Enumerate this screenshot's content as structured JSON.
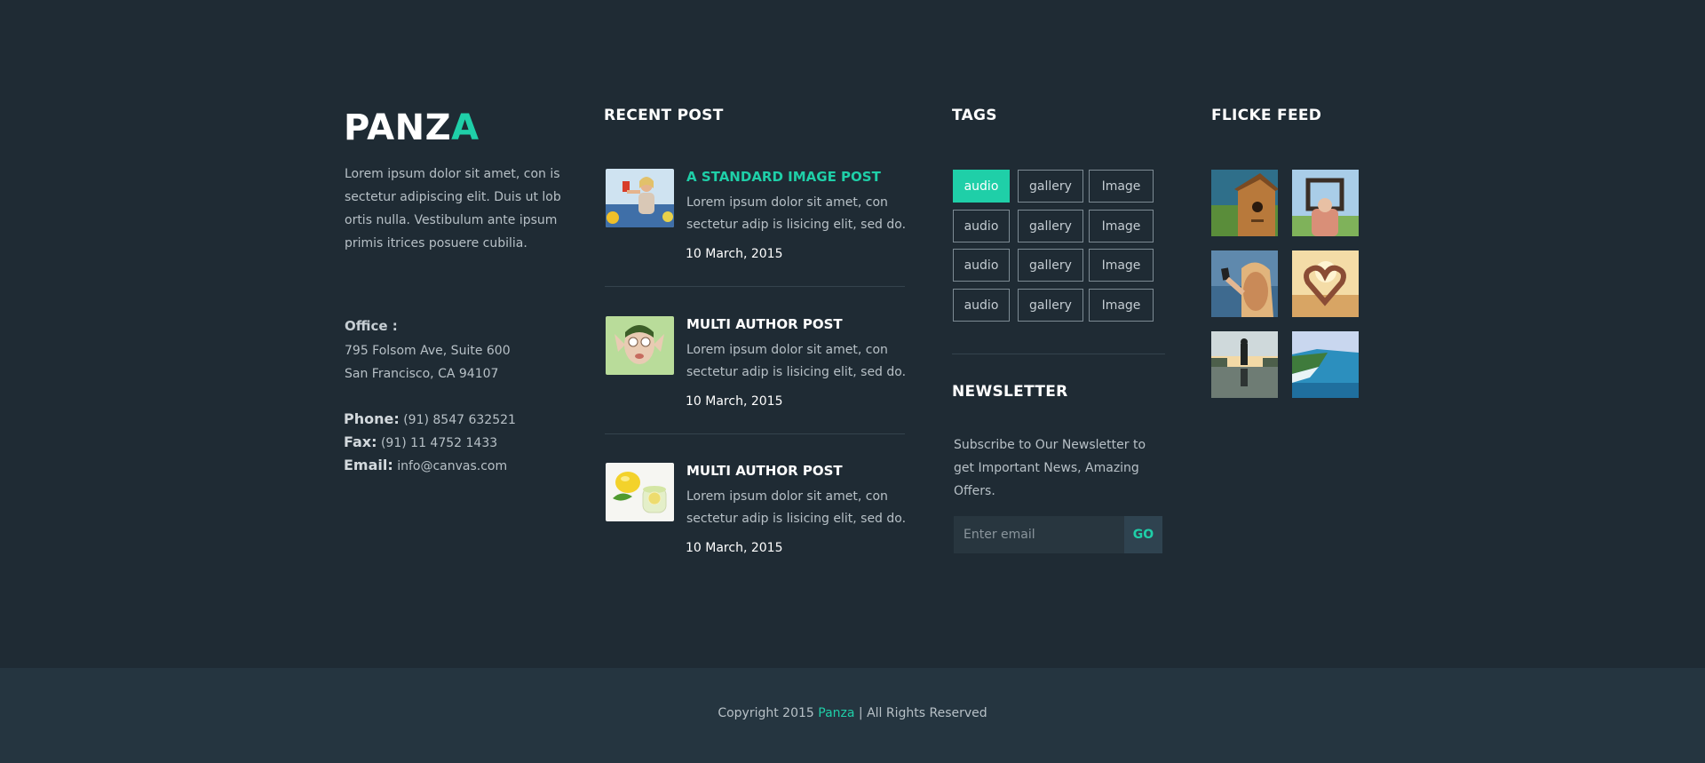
{
  "brand": {
    "logo_main": "PANZ",
    "logo_accent": "A",
    "accent_color": "#1fcfa8"
  },
  "about": {
    "text": "Lorem ipsum dolor sit amet, con is sectetur adipiscing elit. Duis ut lob ortis nulla. Vestibulum ante ipsum primis itrices posuere cubilia."
  },
  "office": {
    "label": "Office :",
    "address_line1": "795 Folsom Ave, Suite 600",
    "address_line2": "San Francisco, CA 94107"
  },
  "contact": {
    "phone_label": "Phone:",
    "phone": "(91) 8547 632521",
    "fax_label": "Fax:",
    "fax": "(91) 11 4752 1433",
    "email_label": "Email:",
    "email": "info@canvas.com"
  },
  "recent_posts": {
    "heading": "RECENT POST",
    "items": [
      {
        "title": "A STANDARD IMAGE POST",
        "excerpt": "Lorem ipsum dolor sit amet, con sectetur adip is lisicing elit, sed do.",
        "date": "10 March, 2015",
        "thumb_icon": "woman-drink-photo"
      },
      {
        "title": "MULTI AUTHOR POST",
        "excerpt": "Lorem ipsum dolor sit amet, con sectetur adip is lisicing elit, sed do.",
        "date": "10 March, 2015",
        "thumb_icon": "face-mask-photo"
      },
      {
        "title": "MULTI AUTHOR POST",
        "excerpt": "Lorem ipsum dolor sit amet, con sectetur adip is lisicing elit, sed do.",
        "date": "10 March, 2015",
        "thumb_icon": "lemon-photo"
      }
    ]
  },
  "tags": {
    "heading": "TAGS",
    "rows": [
      [
        "audio",
        "gallery",
        "Image"
      ],
      [
        "audio",
        "gallery",
        "Image"
      ],
      [
        "audio",
        "gallery",
        "Image"
      ],
      [
        "audio",
        "gallery",
        "Image"
      ]
    ],
    "active_tag": "audio (row 1)"
  },
  "newsletter": {
    "heading": "NEWSLETTER",
    "text": "Subscribe to Our Newsletter to get Important News,  Amazing Offers.",
    "placeholder": "Enter email",
    "button_label": "GO"
  },
  "flickr": {
    "heading": "FLICKE FEED",
    "images": [
      "birdhouse-photo",
      "frame-photo",
      "selfie-photo",
      "heart-hands-photo",
      "reflection-photo",
      "coast-photo"
    ]
  },
  "copyright": {
    "prefix": "Copyright 2015 ",
    "brand": "Panza",
    "suffix": " | All Rights Reserved"
  }
}
